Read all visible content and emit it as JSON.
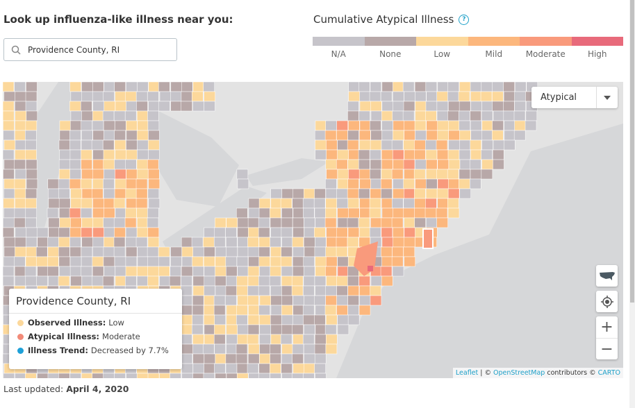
{
  "lookup": {
    "title": "Look up influenza-like illness near you:",
    "search_value": "Providence County, RI",
    "search_icon": "search-icon"
  },
  "legend": {
    "title": "Cumulative Atypical Illness",
    "help_icon": "?",
    "levels": [
      {
        "label": "N/A",
        "color": "#c6c4ca"
      },
      {
        "label": "None",
        "color": "#b8a8a8"
      },
      {
        "label": "Low",
        "color": "#fcd89b"
      },
      {
        "label": "Mild",
        "color": "#fcb77d"
      },
      {
        "label": "Moderate",
        "color": "#f99a7c"
      },
      {
        "label": "High",
        "color": "#e86a7b"
      }
    ]
  },
  "map": {
    "layer_select": "Atypical",
    "controls": {
      "zoom_in": "+",
      "zoom_out": "−"
    },
    "attribution": {
      "leaflet": "Leaflet",
      "sep": " | © ",
      "osm": "OpenStreetMap",
      "contrib": " contributors © ",
      "carto": "CARTO"
    },
    "popup": {
      "title": "Providence County, RI",
      "rows": [
        {
          "label": "Observed Illness:",
          "value": "Low",
          "color": "#fcd89b"
        },
        {
          "label": "Atypical Illness:",
          "value": "Moderate",
          "color": "#f28a78"
        },
        {
          "label": "Illness Trend:",
          "value": "Decreased by 7.7%",
          "color": "#1ea0d8"
        }
      ]
    }
  },
  "footer": {
    "label": "Last updated:",
    "date": "April 4, 2020"
  }
}
